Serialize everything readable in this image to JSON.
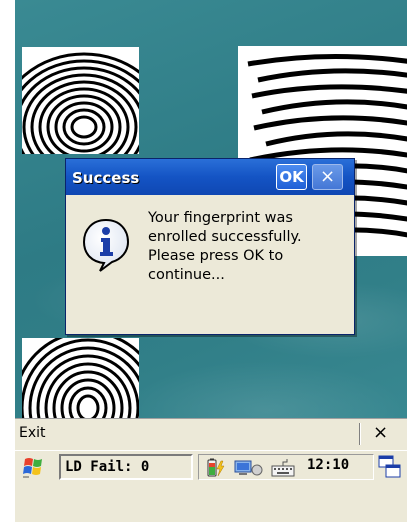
{
  "colors": {
    "desktop": "#317f88",
    "titlebar": "#1454c4",
    "dialog_bg": "#ece9d8"
  },
  "dialog": {
    "title": "Success",
    "ok_label": "OK",
    "close_label": "×",
    "icon": "info-icon",
    "message_lines": [
      "Your fingerprint was",
      "enrolled successfully.",
      "Please press OK to",
      "continue..."
    ]
  },
  "command_bar": {
    "exit_label": "Exit",
    "close_label": "×"
  },
  "taskbar": {
    "start_icon": "windows-flag-icon",
    "status_text": "LD Fail: 0",
    "tray_icons": [
      "battery-icon",
      "network-icon",
      "keyboard-icon"
    ],
    "clock": "12:10",
    "switch_icon": "window-switch-icon"
  }
}
